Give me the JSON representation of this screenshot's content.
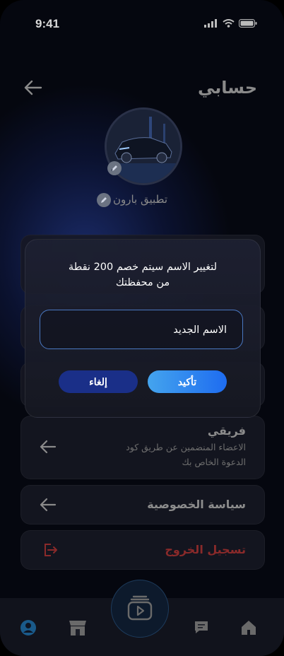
{
  "status_bar": {
    "time": "9:41"
  },
  "header": {
    "title": "حسابي"
  },
  "profile": {
    "username": "تطبيق بارون"
  },
  "menu": {
    "team": {
      "title": "فريقي",
      "subtitle_line1": "الاعضاء المنضمين عن طريق كود",
      "subtitle_line2": "الدعوة الخاص بك"
    },
    "privacy": {
      "title": "سياسة الخصوصية"
    },
    "logout": {
      "title": "تسجيل الخروج"
    }
  },
  "dialog": {
    "message_line1": "لتغيير الاسم سيتم خصم 200 نقطة",
    "message_line2": "من محفظتك",
    "input_placeholder": "الاسم الجديد",
    "confirm_label": "تأكيد",
    "cancel_label": "إلغاء"
  },
  "colors": {
    "accent": "#1e6cf0",
    "accent_light": "#44a4ee",
    "cancel": "#1a2f88",
    "danger": "#8a2a2a"
  },
  "icons": [
    "back-arrow-icon",
    "edit-pencil-icon",
    "arrow-left-icon",
    "logout-icon",
    "profile-icon",
    "store-icon",
    "video-library-icon",
    "chat-icon",
    "home-icon"
  ]
}
